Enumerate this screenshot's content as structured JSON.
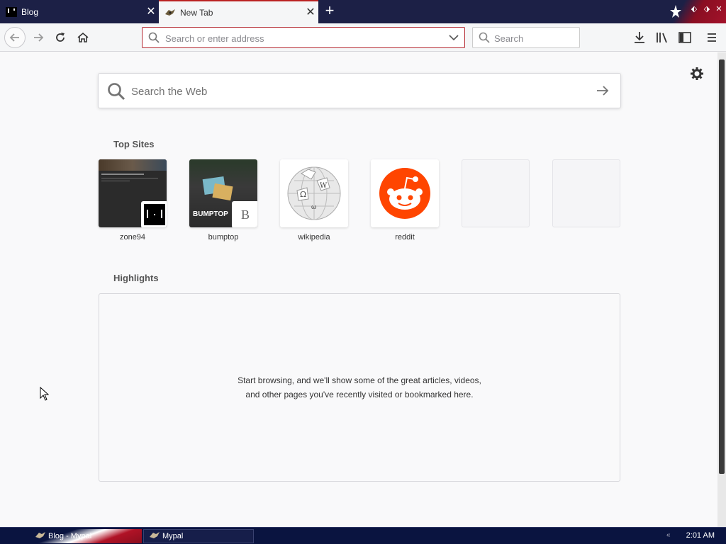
{
  "tabs": [
    {
      "title": "Blog",
      "icon": "blog-favicon",
      "active": false
    },
    {
      "title": "New Tab",
      "icon": "mypal-favicon",
      "active": true
    }
  ],
  "colors": {
    "tab_bar": "#1c2046",
    "active_tab_accent": "#b22222",
    "urlbar_border": "#b42a32",
    "content_bg": "#f9f9fa",
    "taskbar": "#0a1440",
    "reddit_orange": "#ff4500"
  },
  "navbar": {
    "url_placeholder": "Search or enter address",
    "search_placeholder": "Search"
  },
  "newtab": {
    "web_search_placeholder": "Search the Web",
    "top_sites_title": "Top Sites",
    "top_sites": [
      {
        "label": "zone94",
        "badge_icon": "zone94-badge-icon"
      },
      {
        "label": "bumptop",
        "badge": "B",
        "thumb_caption": "BUMPTOP"
      },
      {
        "label": "wikipedia"
      },
      {
        "label": "reddit"
      },
      {
        "label": ""
      },
      {
        "label": ""
      }
    ],
    "highlights_title": "Highlights",
    "highlights_empty": "Start browsing, and we'll show some of the great articles, videos, and other pages you've recently visited or bookmarked here."
  },
  "taskbar": {
    "items": [
      {
        "label": "Blog - Mypal"
      },
      {
        "label": "Mypal"
      }
    ],
    "clock": "2:01 AM"
  }
}
